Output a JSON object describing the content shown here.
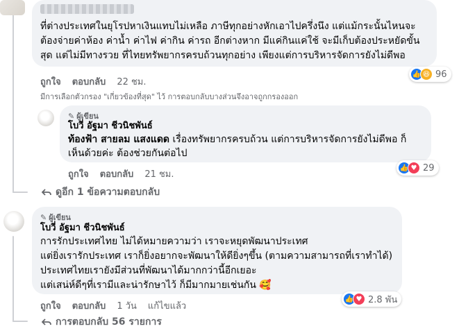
{
  "comment1": {
    "lines": [
      "ที่ต่างประเทศในยุโรปหาเงินแทบไม่เหลือ ภาษีทุกอย่างหักเอาไปครึ่งนึง แต่แม้กระนั้นไหนจะ",
      "ต้องจ่ายค่าห้อง ค่าน้ำ ค่าไฟ ค่ากิน ค่ารถ อีกต่างหาก มีแค่กินแค่ใช้ จะมีเก็บต้องประหยัดขั้น",
      "สุด แต่ไม่มีทางรวย ที่ไทยทรัพยากรครบถ้วนทุกอย่าง เพียงแต่การบริหารจัดการยังไม่ดีพอ"
    ],
    "actions": {
      "like": "ถูกใจ",
      "reply": "ตอบกลับ",
      "time": "22 ชม."
    },
    "reaction_count": "96",
    "filter_note": "มีการเลือกตัวกรอง \"เกี่ยวข้องที่สุด\" ไว้ การตอบกลับบางส่วนจึงอาจถูกกรองออก"
  },
  "reply1": {
    "author_tag": "ผู้เขียน",
    "author": "โบวี่ อัฐมา ชีวนิชพันธ์",
    "mention": "ท้องฟ้า สายลม แสงแดด",
    "line1_rest": " เรื่องทรัพยากรครบถ้วน แต่การบริหารจัดการยังไม่ดีพอ ก็",
    "line2": "เห็นด้วยค่ะ ต้องช่วยกันต่อไป",
    "actions": {
      "like": "ถูกใจ",
      "reply": "ตอบกลับ",
      "time": "21 ชม."
    },
    "reaction_count": "29"
  },
  "see_more_replies": "ดูอีก 1 ข้อความตอบกลับ",
  "comment2": {
    "author_tag": "ผู้เขียน",
    "author": "โบวี่ อัฐมา ชีวนิชพันธ์",
    "lines": [
      "การรักประเทศไทย ไม่ได้หมายความว่า เราจะหยุดพัฒนาประเทศ",
      "แต่ยิ่งเรารักประเทศ เราก็ยิ่งอยากจะพัฒนาให้ดียิ่งๆขึ้น (ตามความสามารถที่เราทำได้)",
      "ประเทศไทยเรายังมีส่วนที่พัฒนาได้มากกว่านี้อีกเยอะ",
      "แต่เสน่ห์ดีๆที่เรามีและน่ารักษาไว้ ก็มีมากมายเช่นกัน"
    ],
    "emoji": "🥰",
    "actions": {
      "like": "ถูกใจ",
      "reply": "ตอบกลับ",
      "time": "1 วัน",
      "edited": "แก้ไขแล้ว"
    },
    "reaction_count": "2.8 พัน"
  },
  "all_replies": "การตอบกลับ 56 รายการ",
  "colors": {
    "like": "#1877f2",
    "heart": "#f33e58",
    "emoji": "#f7b125",
    "muted": "#65676b",
    "bubble": "#f0f2f5"
  }
}
